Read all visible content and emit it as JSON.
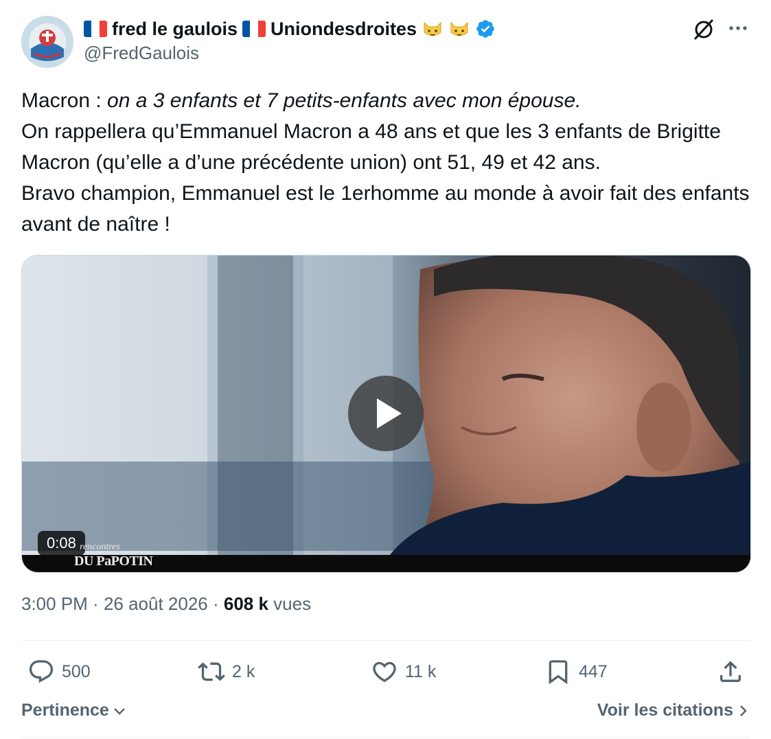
{
  "author": {
    "display_name_part1": "fred le gaulois",
    "display_name_part2": "Uniondesdroites",
    "handle": "@FredGaulois",
    "verified": true,
    "flag_colors": [
      "#0055a4",
      "#ffffff",
      "#ef4135"
    ]
  },
  "tweet": {
    "line1_prefix": "Macron : ",
    "line1_italic": "on a 3 enfants et 7 petits-enfants avec mon épouse.",
    "line2": "On rappellera qu’Emmanuel Macron a 48 ans et que les 3 enfants de Brigitte Macron (qu’elle a d’une précédente union) ont 51, 49 et 42 ans.",
    "line3": "Bravo champion, Emmanuel est le 1erhomme au monde à avoir fait des enfants avant de naître !"
  },
  "video": {
    "duration": "0:08",
    "watermark_top": "rencontres",
    "watermark_bottom": "DU PaPOTIN"
  },
  "meta": {
    "time": "3:00 PM",
    "separator": " · ",
    "date": "26 août 2026",
    "views_count": "608 k",
    "views_label": " vues"
  },
  "actions": {
    "replies": "500",
    "reposts": "2 k",
    "likes": "11 k",
    "bookmarks": "447"
  },
  "footer": {
    "sort_label": "Pertinence",
    "quotes_label": "Voir les citations"
  },
  "colors": {
    "text_primary": "#0f1419",
    "text_secondary": "#536471",
    "verified_blue": "#1d9bf0"
  }
}
